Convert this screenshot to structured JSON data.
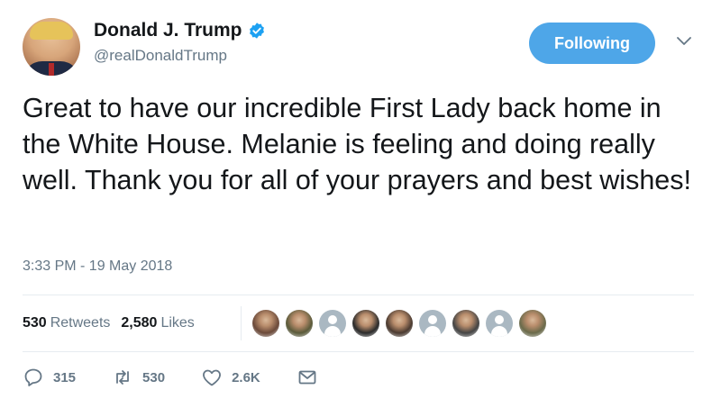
{
  "author": {
    "display_name": "Donald J. Trump",
    "handle": "@realDonaldTrump",
    "verified": true
  },
  "follow_button": {
    "label": "Following"
  },
  "tweet": {
    "text": "Great to have our incredible First Lady back home in the White House. Melanie is feeling and doing really well. Thank you for all of your prayers and best wishes!",
    "timestamp": "3:33 PM - 19 May 2018"
  },
  "stats": {
    "retweets_count": "530",
    "retweets_label": "Retweets",
    "likes_count": "2,580",
    "likes_label": "Likes"
  },
  "likers": [
    {
      "kind": "photo",
      "color": "#6b4a3a"
    },
    {
      "kind": "photo",
      "color": "#5a5a3a"
    },
    {
      "kind": "default",
      "color": "#aab8c2"
    },
    {
      "kind": "photo",
      "color": "#2b2b2b"
    },
    {
      "kind": "photo",
      "color": "#4a3a30"
    },
    {
      "kind": "default",
      "color": "#aab8c2"
    },
    {
      "kind": "photo",
      "color": "#444444"
    },
    {
      "kind": "default",
      "color": "#aab8c2"
    },
    {
      "kind": "photo",
      "color": "#6a6a4a"
    }
  ],
  "actions": {
    "reply_count": "315",
    "retweet_count": "530",
    "like_count": "2.6K"
  },
  "colors": {
    "accent": "#4ea6e8",
    "verified": "#1da1f2",
    "muted": "#657786"
  }
}
